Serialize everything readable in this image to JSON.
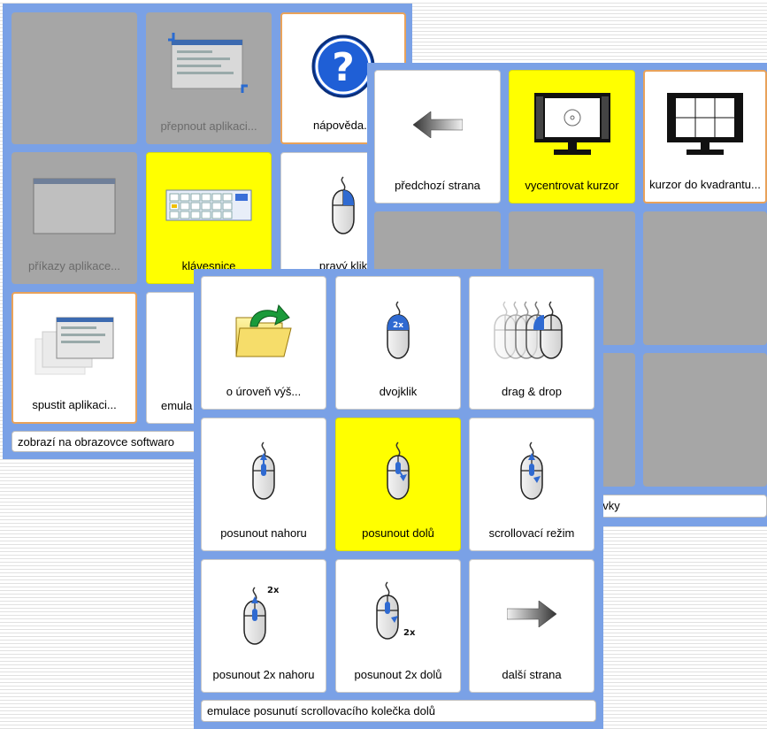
{
  "back_panel": {
    "cells": [
      {
        "label": "",
        "style": "empty"
      },
      {
        "label": "přepnout aplikaci...",
        "style": "gray",
        "icon": "app-window-switch-icon"
      },
      {
        "label": "nápověda...",
        "style": "white",
        "icon": "help-question-icon"
      },
      {
        "label": "příkazy aplikace...",
        "style": "gray",
        "icon": "app-window-icon"
      },
      {
        "label": "klávesnice",
        "style": "yellow",
        "icon": "keyboard-icon"
      },
      {
        "label": "pravý klik",
        "style": "white",
        "icon": "mouse-right-click-icon"
      },
      {
        "label": "spustit aplikaci...",
        "style": "white",
        "icon": "app-launch-icon"
      },
      {
        "label": "emula",
        "style": "white",
        "icon": "mouse-icon"
      }
    ],
    "status": "zobrazí na obrazovce softwaro"
  },
  "mid_panel": {
    "cells": [
      {
        "label": "předchozí strana",
        "style": "white",
        "icon": "arrow-left-icon"
      },
      {
        "label": "vycentrovat kurzor",
        "style": "yellow",
        "icon": "monitor-center-cursor-icon"
      },
      {
        "label": "kurzor do kvadrantu...",
        "style": "white",
        "icon": "monitor-quadrant-icon"
      }
    ],
    "status": "ovky"
  },
  "front_panel": {
    "cells": [
      {
        "label": "o úroveň výš...",
        "style": "white",
        "icon": "folder-up-icon"
      },
      {
        "label": "dvojklik",
        "style": "white",
        "icon": "mouse-double-click-icon",
        "badge": "2x"
      },
      {
        "label": "drag & drop",
        "style": "white",
        "icon": "mouse-drag-drop-icon"
      },
      {
        "label": "posunout nahoru",
        "style": "white",
        "icon": "mouse-scroll-up-icon"
      },
      {
        "label": "posunout dolů",
        "style": "yellow",
        "icon": "mouse-scroll-down-icon"
      },
      {
        "label": "scrollovací režim",
        "style": "white",
        "icon": "mouse-scroll-mode-icon"
      },
      {
        "label": "posunout 2x nahoru",
        "style": "white",
        "icon": "mouse-scroll-up-2x-icon",
        "badge": "2x"
      },
      {
        "label": "posunout 2x dolů",
        "style": "white",
        "icon": "mouse-scroll-down-2x-icon",
        "badge": "2x"
      },
      {
        "label": "další strana",
        "style": "white",
        "icon": "arrow-right-icon"
      }
    ],
    "status": "emulace posunutí scrollovacího kolečka dolů"
  },
  "colors": {
    "panel": "#7aa1e6",
    "selected": "#ffff00",
    "disabled": "#a6a6a6",
    "accent_border": "#e9a25a"
  }
}
